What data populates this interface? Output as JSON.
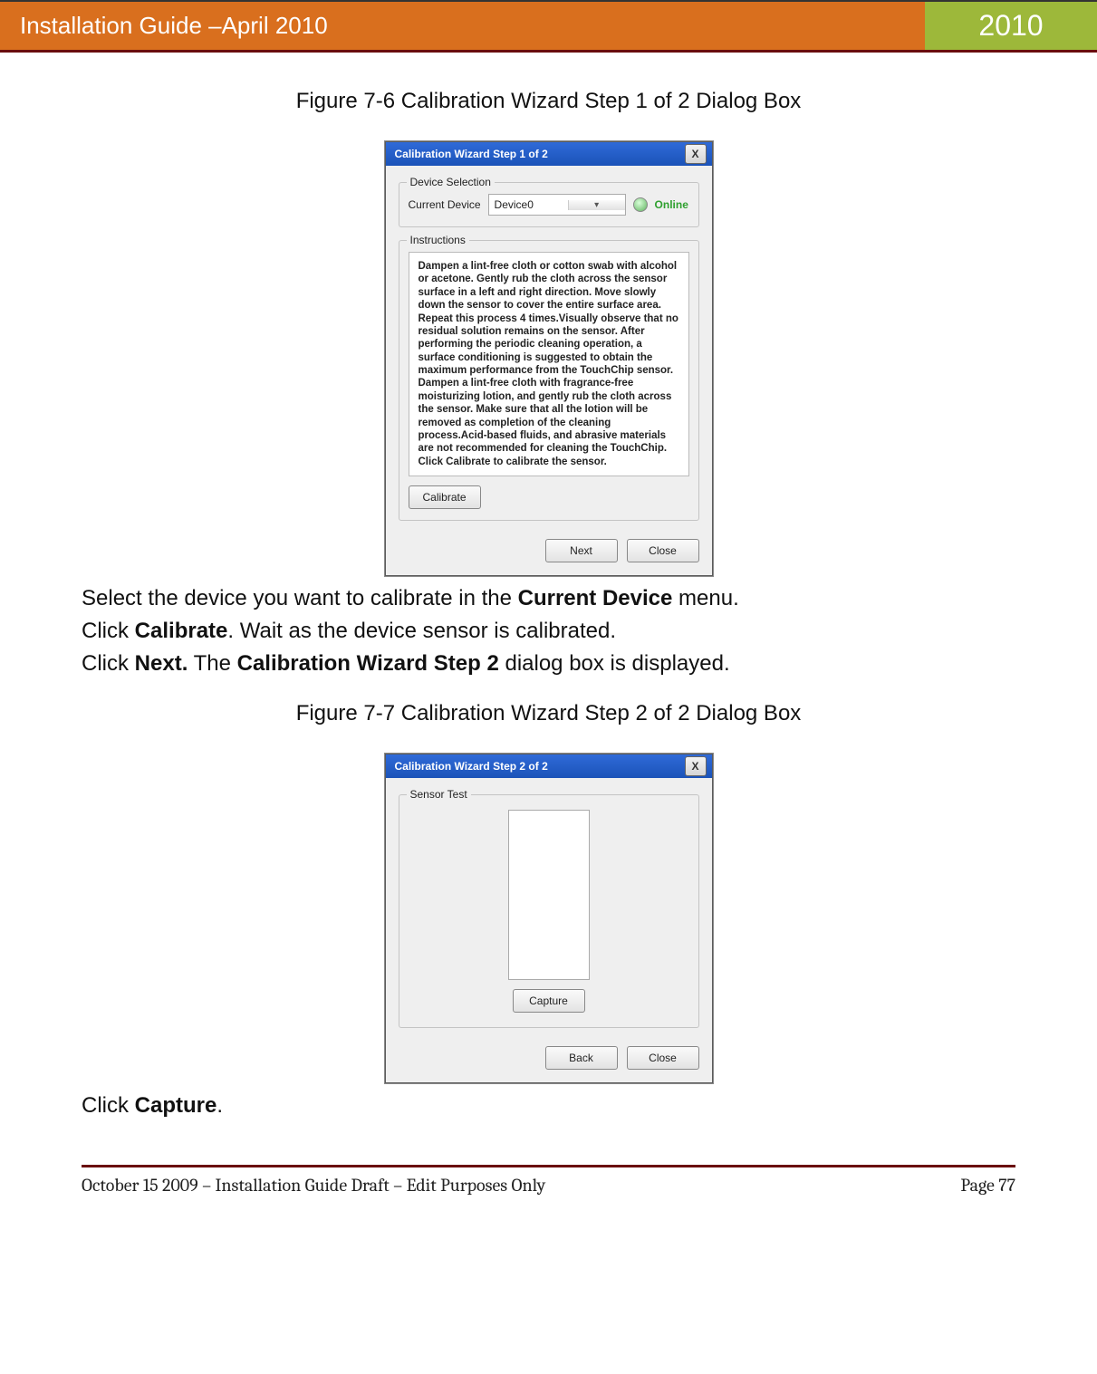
{
  "header": {
    "title_left": "Installation Guide –April 2010",
    "title_right": "2010"
  },
  "figure1": {
    "caption": "Figure 7-6 Calibration Wizard Step 1 of 2 Dialog Box",
    "dialog": {
      "title": "Calibration Wizard Step 1 of 2",
      "close": "X",
      "group_device_label": "Device Selection",
      "current_device_label": "Current Device",
      "current_device_value": "Device0",
      "status_text": "Online",
      "group_instr_label": "Instructions",
      "instructions": "Dampen a lint-free cloth or cotton swab with alcohol or acetone. Gently rub the cloth across the sensor surface in a left and right direction. Move slowly down the sensor to cover the entire surface area. Repeat this process 4 times.Visually observe that no residual solution remains on the sensor. After performing the periodic cleaning operation, a surface conditioning is suggested to obtain the maximum performance from the TouchChip sensor. Dampen a lint-free cloth with fragrance-free moisturizing lotion, and gently rub the cloth across the sensor. Make sure that all the lotion will be removed as completion of the cleaning process.Acid-based fluids, and abrasive materials are not recommended for cleaning the TouchChip. Click Calibrate to calibrate the sensor.",
      "btn_calibrate": "Calibrate",
      "btn_next": "Next",
      "btn_close": "Close"
    }
  },
  "body1": {
    "line1_pre": "Select the device you want to calibrate in the ",
    "line1_b": "Current Device",
    "line1_post": " menu.",
    "line2_pre": "Click ",
    "line2_b": "Calibrate",
    "line2_post": ". Wait as the device sensor is calibrated.",
    "line3_pre": "Click ",
    "line3_b1": "Next.",
    "line3_mid": " The ",
    "line3_b2": "Calibration Wizard Step 2",
    "line3_post": " dialog box is displayed."
  },
  "figure2": {
    "caption": "Figure 7-7 Calibration Wizard Step 2 of 2 Dialog Box",
    "dialog": {
      "title": "Calibration Wizard Step 2 of 2",
      "close": "X",
      "group_label": "Sensor Test",
      "btn_capture": "Capture",
      "btn_back": "Back",
      "btn_close": "Close"
    }
  },
  "body2": {
    "pre": "Click ",
    "b": "Capture",
    "post": "."
  },
  "footer": {
    "left": "October 15 2009 – Installation Guide Draft – Edit Purposes Only",
    "right": "Page 77"
  }
}
